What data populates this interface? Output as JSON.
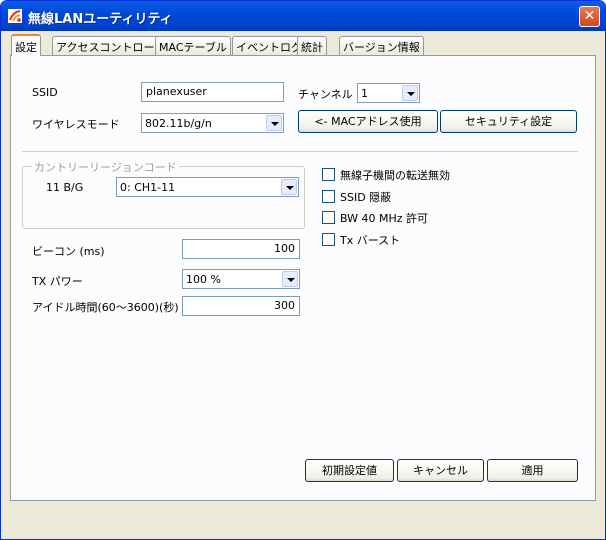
{
  "window": {
    "title": "無線LANユーティリティ",
    "close_glyph": "✕"
  },
  "tabs": [
    {
      "label": "設定"
    },
    {
      "label": "アクセスコントロール"
    },
    {
      "label": "MACテーブル"
    },
    {
      "label": "イベントログ"
    },
    {
      "label": "統計"
    },
    {
      "label": "バージョン情報"
    }
  ],
  "settings": {
    "ssid_label": "SSID",
    "ssid_value": "planexuser",
    "channel_label": "チャンネル",
    "channel_value": "1",
    "wireless_mode_label": "ワイヤレスモード",
    "wireless_mode_value": "802.11b/g/n",
    "mac_address_button": "<- MACアドレス使用",
    "security_button": "セキュリティ設定",
    "country_region_title": "カントリーリージョンコード",
    "band_label": "11 B/G",
    "region_value": "0: CH1-11",
    "beacon_label": "ビーコン (ms)",
    "beacon_value": "100",
    "tx_power_label": "TX パワー",
    "tx_power_value": "100 %",
    "idle_time_label": "アイドル時間(60～3600)(秒)",
    "idle_time_value": "300",
    "checkboxes": [
      {
        "label": "無線子機間の転送無効",
        "checked": false
      },
      {
        "label": "SSID 隠蔽",
        "checked": false
      },
      {
        "label": "BW 40 MHz 許可",
        "checked": false
      },
      {
        "label": "Tx バースト",
        "checked": false
      }
    ]
  },
  "footer": {
    "defaults_button": "初期設定値",
    "cancel_button": "キャンセル",
    "apply_button": "適用"
  }
}
